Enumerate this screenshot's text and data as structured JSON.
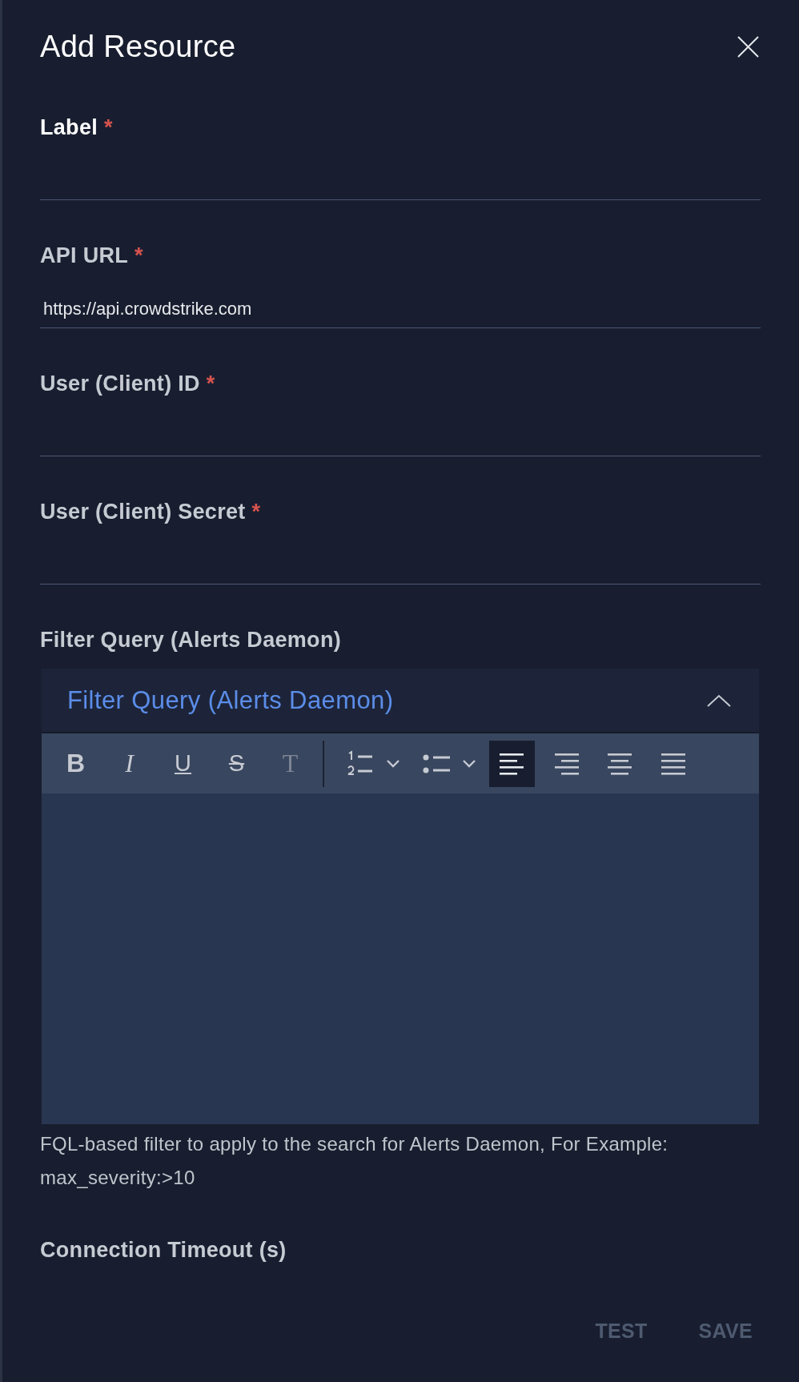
{
  "dialog": {
    "title": "Add Resource",
    "close_icon": true
  },
  "fields": [
    {
      "kind": "text",
      "label": "Label",
      "required_mark": "*",
      "focused": true
    },
    {
      "kind": "text",
      "label": "API URL",
      "required_mark": "*",
      "focused": false,
      "value": "https://api.crowdstrike.com"
    },
    {
      "kind": "text",
      "label": "User (Client) ID",
      "required_mark": "*",
      "focused": false
    },
    {
      "kind": "text",
      "label": "User (Client) Secret",
      "required_mark": "*",
      "focused": false
    },
    {
      "kind": "editor",
      "label": "Filter Query (Alerts Daemon)",
      "focused": false,
      "panel_title": "Filter Query (Alerts Daemon)",
      "expanded": true,
      "toolbar": [
        {
          "kind": "bold",
          "glyph": "B",
          "selected": false,
          "disabled": false
        },
        {
          "kind": "italic",
          "glyph": "I",
          "selected": false,
          "disabled": false
        },
        {
          "kind": "underline",
          "glyph": "U",
          "selected": false,
          "disabled": false
        },
        {
          "kind": "strike",
          "glyph": "S",
          "selected": false,
          "disabled": false
        },
        {
          "kind": "clear",
          "glyph": "T",
          "selected": false,
          "disabled": true
        },
        {
          "kind": "separator"
        },
        {
          "kind": "ordered-list",
          "selected": false,
          "disabled": false
        },
        {
          "kind": "dropdown",
          "selected": false,
          "disabled": false
        },
        {
          "kind": "bullet-list",
          "selected": false,
          "disabled": false
        },
        {
          "kind": "dropdown",
          "selected": false,
          "disabled": false
        },
        {
          "kind": "align-left",
          "selected": true,
          "disabled": false
        },
        {
          "kind": "align-right",
          "selected": false,
          "disabled": false
        },
        {
          "kind": "align-center",
          "selected": false,
          "disabled": false
        },
        {
          "kind": "justify",
          "selected": false,
          "disabled": false
        }
      ],
      "help": "FQL-based filter to apply to the search for Alerts Daemon, For Example: max_severity:>10"
    },
    {
      "kind": "label-only",
      "label": "Connection Timeout (s)",
      "focused": false
    }
  ],
  "buttons": [
    {
      "label": "TEST",
      "disabled": true
    },
    {
      "label": "SAVE",
      "disabled": true
    }
  ]
}
